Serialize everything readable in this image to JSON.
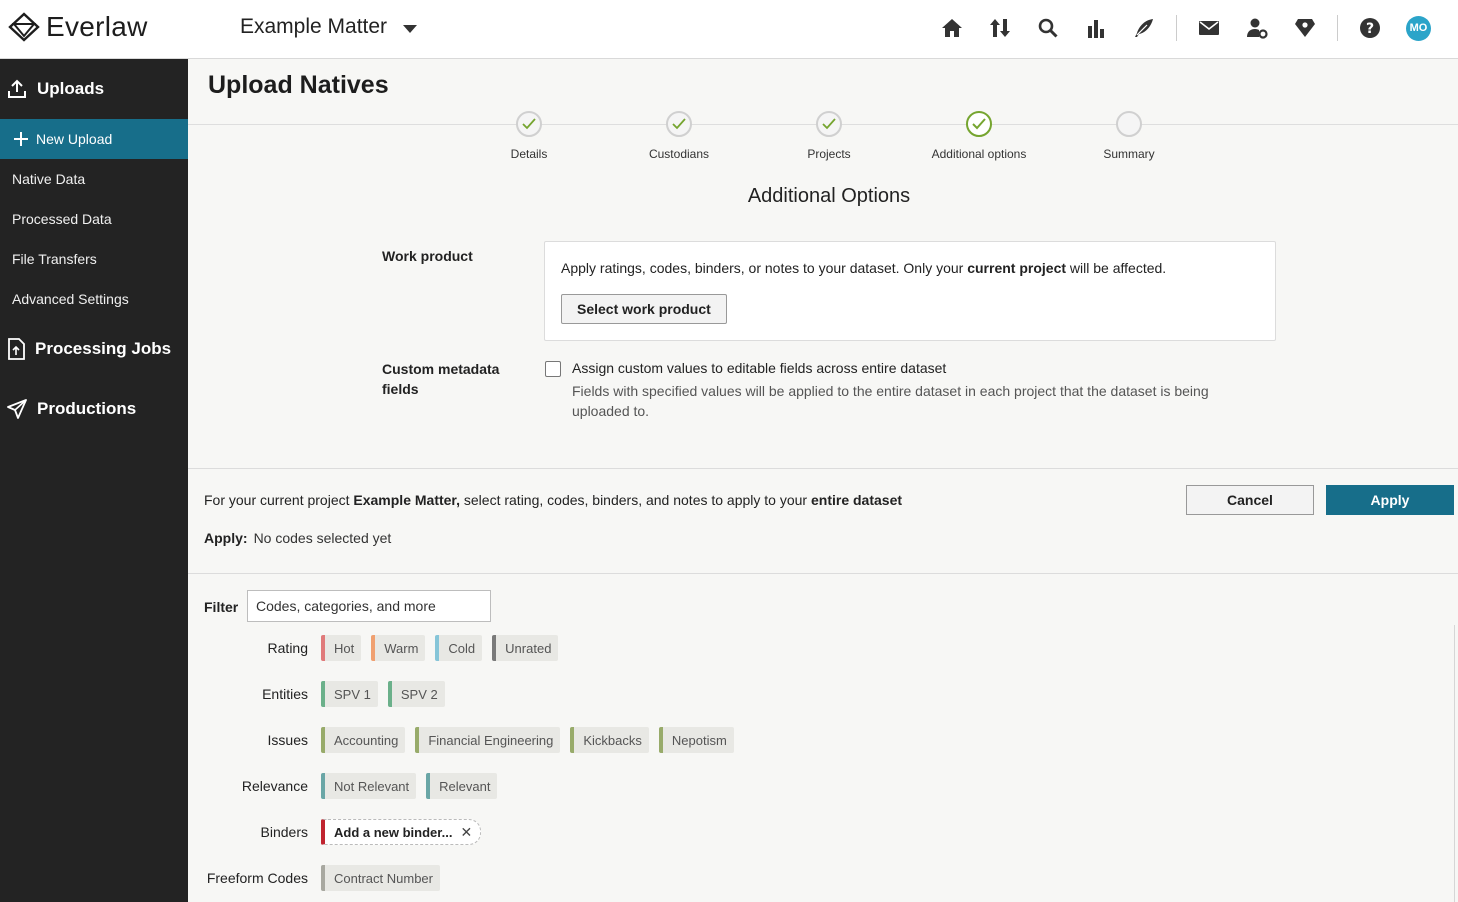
{
  "app": {
    "name": "Everlaw",
    "matter": "Example Matter"
  },
  "topnav": {
    "icons": [
      "home-icon",
      "upload-download-icon",
      "search-icon",
      "analytics-icon",
      "feather-pen-icon",
      "mail-icon",
      "user-settings-icon",
      "shield-icon",
      "help-icon"
    ],
    "avatar_initials": "MO",
    "avatar_color": "#2ba4c9"
  },
  "sidebar": {
    "uploads": "Uploads",
    "items": [
      {
        "label": "New Upload"
      },
      {
        "label": "Native Data"
      },
      {
        "label": "Processed Data"
      },
      {
        "label": "File Transfers"
      },
      {
        "label": "Advanced Settings"
      }
    ],
    "processing_jobs": "Processing Jobs",
    "productions": "Productions"
  },
  "page": {
    "title": "Upload Natives",
    "steps": [
      {
        "label": "Details",
        "done": true
      },
      {
        "label": "Custodians",
        "done": true
      },
      {
        "label": "Projects",
        "done": true
      },
      {
        "label": "Additional options",
        "done": true,
        "current": true
      },
      {
        "label": "Summary",
        "done": false
      }
    ],
    "heading": "Additional Options"
  },
  "work_product": {
    "label": "Work product",
    "text_before": "Apply ratings, codes, binders, or notes to your dataset. Only your ",
    "text_bold": "current project",
    "text_after": " will be affected.",
    "button": "Select work product"
  },
  "custom_metadata": {
    "label": "Custom metadata fields",
    "checkbox_label": "Assign custom values to editable fields across entire dataset",
    "checked": false,
    "description": "Fields with specified values will be applied to the entire dataset in each project that the dataset is being uploaded to."
  },
  "panel": {
    "desc_1": "For your current project ",
    "desc_matter": "Example Matter,",
    "desc_2": " select rating, codes, binders, and notes to apply to your ",
    "desc_bold": "entire dataset",
    "cancel": "Cancel",
    "apply": "Apply",
    "apply_label": "Apply:",
    "apply_value": "No codes selected yet",
    "filter_label": "Filter",
    "filter_placeholder": "Codes, categories, and more"
  },
  "code_rows": [
    {
      "label": "Rating",
      "chips": [
        {
          "text": "Hot",
          "color": "#e07a7a"
        },
        {
          "text": "Warm",
          "color": "#f0a070"
        },
        {
          "text": "Cold",
          "color": "#86c5d8"
        },
        {
          "text": "Unrated",
          "color": "#7a7a7a"
        }
      ]
    },
    {
      "label": "Entities",
      "chips": [
        {
          "text": "SPV 1",
          "color": "#6bb08a"
        },
        {
          "text": "SPV 2",
          "color": "#6bb08a"
        }
      ]
    },
    {
      "label": "Issues",
      "chips": [
        {
          "text": "Accounting",
          "color": "#98ab6a"
        },
        {
          "text": "Financial Engineering",
          "color": "#98ab6a"
        },
        {
          "text": "Kickbacks",
          "color": "#98ab6a"
        },
        {
          "text": "Nepotism",
          "color": "#98ab6a"
        }
      ]
    },
    {
      "label": "Relevance",
      "chips": [
        {
          "text": "Not Relevant",
          "color": "#6aa6a6"
        },
        {
          "text": "Relevant",
          "color": "#6aa6a6"
        }
      ]
    },
    {
      "label": "Binders",
      "chips": [
        {
          "text": "Add a new binder...",
          "color": "#c0242f",
          "dashed": true
        }
      ]
    },
    {
      "label": "Freeform Codes",
      "chips": [
        {
          "text": "Contract Number",
          "color": "#a8a8a0"
        }
      ]
    }
  ]
}
